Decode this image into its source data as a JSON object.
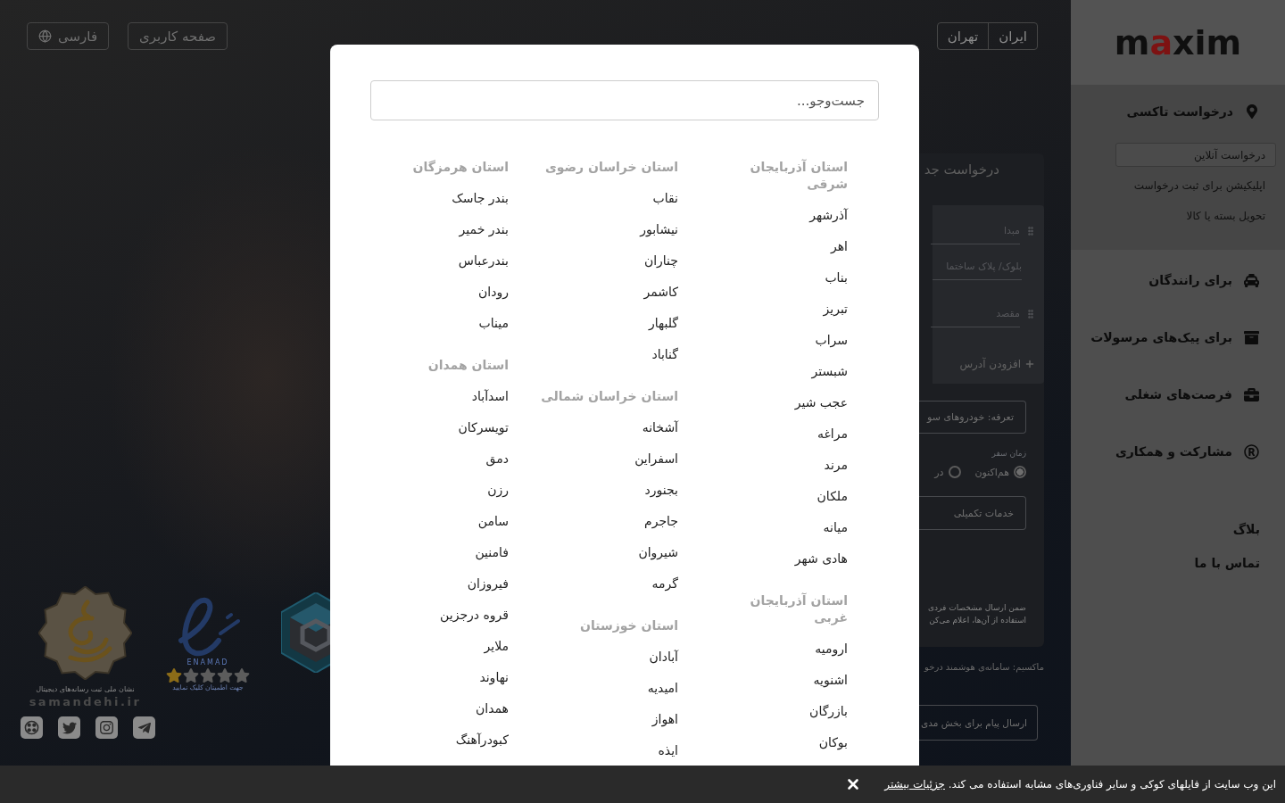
{
  "header": {
    "language_button": "فارسی",
    "profile_button": "صفحه کاربری",
    "location": [
      {
        "label": "ایران"
      },
      {
        "label": "تهران"
      }
    ]
  },
  "sidebar": {
    "logo": "maxim",
    "taxi_section": {
      "title": "درخواست تاکسی",
      "items": [
        {
          "label": "درخواست آنلاین",
          "selected": true
        },
        {
          "label": "اپلیکیشن برای ثبت درخواست",
          "selected": false
        },
        {
          "label": "تحویل بسته یا کالا",
          "selected": false
        }
      ]
    },
    "nav": [
      {
        "label": "برای رانندگان"
      },
      {
        "label": "برای پیک‌های مرسولات"
      },
      {
        "label": "فرصت‌های شغلی"
      },
      {
        "label": "مشارکت و همکاری"
      }
    ],
    "links": [
      {
        "label": "بلاگ"
      },
      {
        "label": "تماس با ما"
      }
    ]
  },
  "order_form": {
    "title": "درخواست جد",
    "addresses": [
      {
        "kind": "point",
        "placeholder": "مبدا"
      },
      {
        "kind": "detail",
        "placeholder": "بلوک/ پلاک ساختما"
      },
      {
        "kind": "point",
        "placeholder": "مقصد"
      }
    ],
    "add_address": "افزودن آدرس",
    "tariff_button": "تعرفه: خودروهای سو",
    "time_label": "زمان سفر",
    "time_options": [
      {
        "label": "هم‌اکنون",
        "selected": true
      },
      {
        "label": "در",
        "selected": false
      }
    ],
    "services_button": "خدمات تکمیلی",
    "notice_lines": [
      "ضمن ارسال مشخصات فردی",
      "استفاده از آن‌ها، اعلام می‌کن"
    ],
    "tagline": "ماکسیم: سامانه‌ی هوشمند درخو",
    "message_button": "ارسال پیام برای بخش مدی"
  },
  "badges": [
    {
      "kind": "seal",
      "caption": "نشان ملی ثبت رسانه‌های دیجیتال",
      "site": "samandehi.ir"
    },
    {
      "kind": "rating",
      "caption": "ENAMAD",
      "stars": 1,
      "note": "جهت اطمینان کلیک نمایید"
    },
    {
      "kind": "cube"
    }
  ],
  "city_dialog": {
    "search": {
      "placeholder": "جست‌وجو..."
    },
    "columns": [
      {
        "groups": [
          {
            "province": "استان آذربایجان شرقی",
            "cities": [
              "آذرشهر",
              "اهر",
              "بناب",
              "تبریز",
              "سراب",
              "شبستر",
              "عجب شیر",
              "مراغه",
              "مرند",
              "ملکان",
              "میانه",
              "هادی شهر"
            ]
          },
          {
            "province": "استان آذربایجان غربی",
            "cities": [
              "ارومیه",
              "اشنویه",
              "بازرگان",
              "بوکان"
            ]
          }
        ]
      },
      {
        "groups": [
          {
            "province": "استان خراسان رضوی",
            "cities": [
              "نقاب",
              "نیشابور",
              "چناران",
              "کاشمر",
              "گلبهار",
              "گناباد"
            ]
          },
          {
            "province": "استان خراسان شمالی",
            "cities": [
              "آشخانه",
              "اسفراین",
              "بجنورد",
              "جاجرم",
              "شیروان",
              "گرمه"
            ]
          },
          {
            "province": "استان خوزستان",
            "cities": [
              "آبادان",
              "امیدیه",
              "اهواز",
              "ایذه"
            ]
          }
        ]
      },
      {
        "groups": [
          {
            "province": "استان هرمزگان",
            "cities": [
              "بندر جاسک",
              "بندر خمیر",
              "بندرعباس",
              "رودان",
              "میناب"
            ]
          },
          {
            "province": "استان همدان",
            "cities": [
              "اسدآباد",
              "تویسرکان",
              "دمق",
              "رزن",
              "سامن",
              "فامنین",
              "فیروزان",
              "قروه درجزین",
              "ملایر",
              "نهاوند",
              "همدان",
              "کبودرآهنگ"
            ]
          }
        ]
      }
    ]
  },
  "cookie_bar": {
    "text": "این وب سایت از فایلهای کوکی و سایر فناوری‌های مشابه استفاده می کند.",
    "link": "جزئیات بیشتر"
  }
}
